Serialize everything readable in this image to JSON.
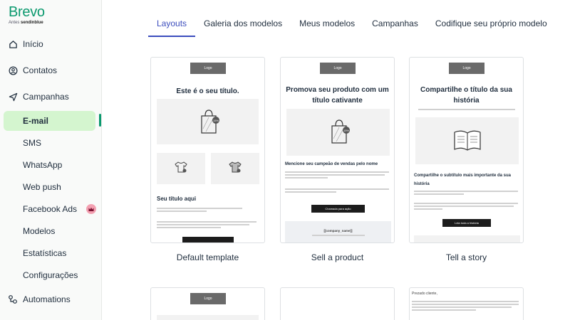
{
  "brand": {
    "name": "Brevo",
    "formerly_prefix": "Antes",
    "formerly_name": "sendinblue",
    "color": "#0b996e"
  },
  "sidebar": {
    "items": [
      {
        "label": "Início",
        "icon": "home-icon"
      },
      {
        "label": "Contatos",
        "icon": "user-circle-icon"
      },
      {
        "label": "Campanhas",
        "icon": "send-icon"
      },
      {
        "label": "E-mail"
      },
      {
        "label": "SMS"
      },
      {
        "label": "WhatsApp"
      },
      {
        "label": "Web push"
      },
      {
        "label": "Facebook Ads"
      },
      {
        "label": "Modelos"
      },
      {
        "label": "Estatísticas"
      },
      {
        "label": "Configurações"
      },
      {
        "label": "Automations",
        "icon": "automation-icon"
      }
    ],
    "active_item": "E-mail",
    "active_color": "#d4f5cf"
  },
  "tabs": [
    {
      "label": "Layouts",
      "active": true
    },
    {
      "label": "Galeria dos modelos"
    },
    {
      "label": "Meus modelos"
    },
    {
      "label": "Campanhas"
    },
    {
      "label": "Codifique seu próprio modelo"
    }
  ],
  "accent_color": "#3c4dbd",
  "templates": [
    {
      "name": "Default template",
      "logo": "Logo",
      "title": "Este é o seu título.",
      "subtitle": "Seu título aqui"
    },
    {
      "name": "Sell a product",
      "logo": "Logo",
      "title": "Promova seu produto com um título cativante",
      "subtitle": "Mencione seu campeão de vendas pelo nome",
      "button": "Chamada para ação",
      "footer": "[[company_name]]"
    },
    {
      "name": "Tell a story",
      "logo": "Logo",
      "title": "Compartilhe o título da sua história",
      "subtitle": "Compartilhe o subtítulo mais importante da sua história",
      "button": "Leia toda a história"
    }
  ],
  "templates_row2": [
    {
      "logo": "Logo"
    },
    {},
    {
      "text": "Prezado cliente,"
    }
  ]
}
